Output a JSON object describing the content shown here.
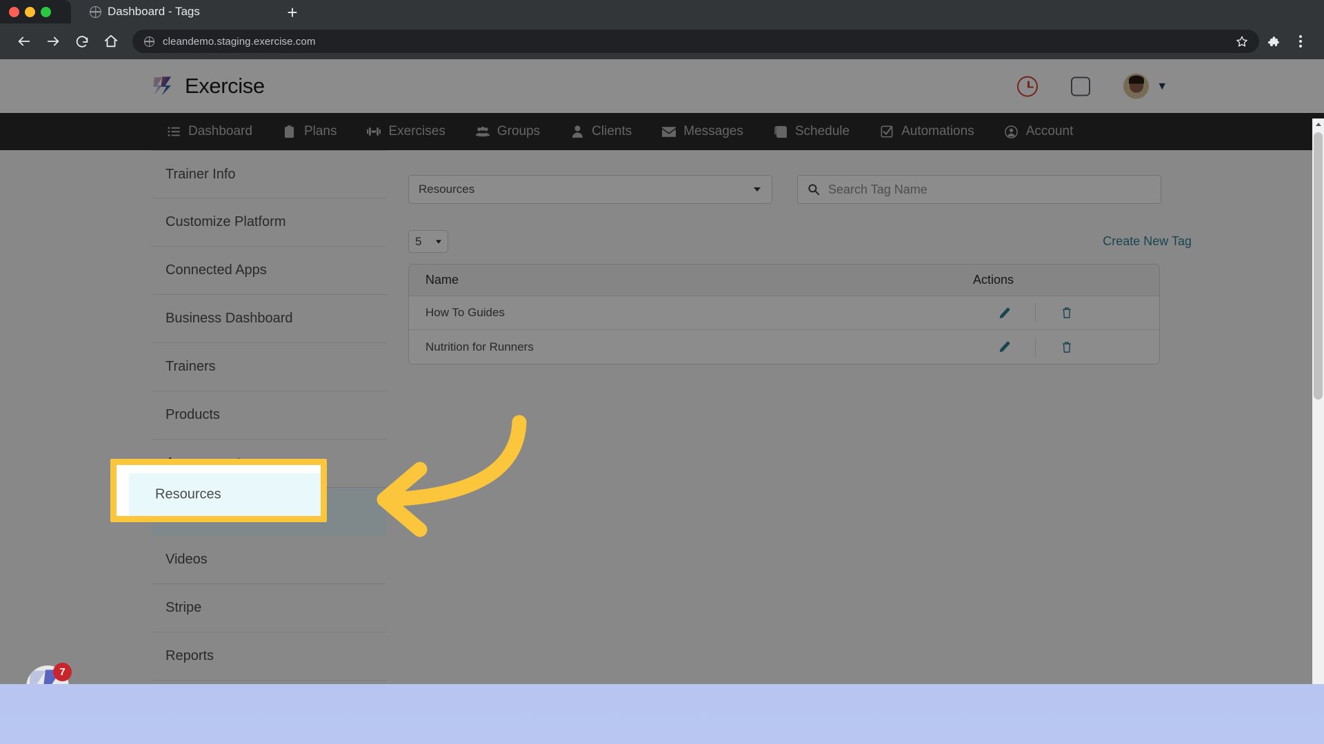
{
  "browser": {
    "tab": {
      "title": "Dashboard - Tags",
      "favicon": "globe-icon"
    },
    "new_tab_label": "+",
    "back_label": "Back",
    "forward_label": "Forward",
    "reload_label": "Reload",
    "home_label": "Home",
    "url": "cleandemo.staging.exercise.com",
    "bookmark_label": "Bookmark this tab",
    "extensions_label": "Extensions",
    "menu_label": "Customize and control"
  },
  "app": {
    "brand": "Exercise",
    "header_icons": [
      {
        "name": "history-clock-icon",
        "color": "#d4402f"
      },
      {
        "name": "screen-square-icon",
        "color": "#5f6368"
      },
      {
        "name": "avatar",
        "color": "#d8c49a"
      }
    ],
    "nav": [
      {
        "label": "Dashboard",
        "icon": "list-icon"
      },
      {
        "label": "Plans",
        "icon": "clipboard-icon"
      },
      {
        "label": "Exercises",
        "icon": "dumbbell-icon"
      },
      {
        "label": "Groups",
        "icon": "people-icon"
      },
      {
        "label": "Clients",
        "icon": "person-icon"
      },
      {
        "label": "Messages",
        "icon": "envelope-icon"
      },
      {
        "label": "Schedule",
        "icon": "book-icon"
      },
      {
        "label": "Automations",
        "icon": "checkbox-icon"
      },
      {
        "label": "Account",
        "icon": "user-circle-icon"
      }
    ]
  },
  "sidebar": {
    "items": [
      {
        "label": "Trainer Info",
        "active": false
      },
      {
        "label": "Customize Platform",
        "active": false
      },
      {
        "label": "Connected Apps",
        "active": false
      },
      {
        "label": "Business Dashboard",
        "active": false
      },
      {
        "label": "Trainers",
        "active": false
      },
      {
        "label": "Products",
        "active": false
      },
      {
        "label": "Assessments",
        "active": false
      },
      {
        "label": "Resources",
        "active": true
      },
      {
        "label": "Videos",
        "active": false
      },
      {
        "label": "Stripe",
        "active": false
      },
      {
        "label": "Reports",
        "active": false
      }
    ]
  },
  "main": {
    "category_select": {
      "value": "Resources",
      "icon": "chevron-down-icon"
    },
    "search": {
      "value": "",
      "placeholder": "Search Tag Name",
      "icon": "search-icon"
    },
    "per_page": {
      "value": "5",
      "icon": "chevron-down-icon"
    },
    "create_link": "Create New Tag",
    "table": {
      "columns": [
        "Name",
        "Actions"
      ],
      "rows": [
        {
          "name": "How To Guides",
          "edit_icon": "pencil-icon",
          "delete_icon": "trash-icon"
        },
        {
          "name": "Nutrition for Runners",
          "edit_icon": "pencil-icon",
          "delete_icon": "trash-icon"
        }
      ]
    }
  },
  "annotations": {
    "highlight_target": "Resources",
    "highlight_color": "#fbc53c",
    "arrow_icon": "curved-left-arrow-icon",
    "arrow_color": "#fbc53c"
  },
  "dock": {
    "app_icon": "exercise-logo-icon",
    "badge_count": "7",
    "badge_color": "#c9252c"
  }
}
